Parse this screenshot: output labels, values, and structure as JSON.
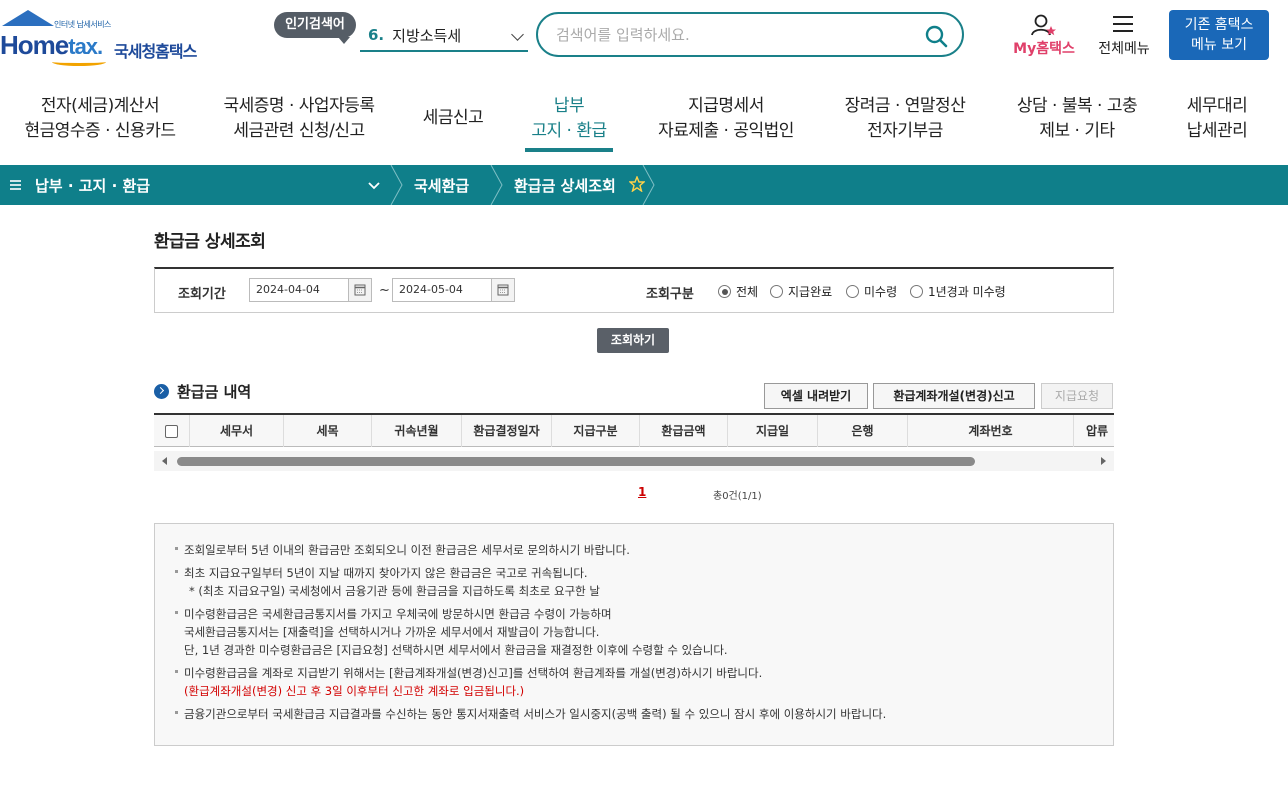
{
  "header": {
    "logo_tagline": "인터넷 납세서비스",
    "logo_home": "Home",
    "logo_tax": "tax.",
    "logo_kr": "국세청홈택스",
    "popular_label": "인기검색어",
    "popular_num": "6.",
    "popular_text": "지방소득세",
    "search_placeholder": "검색어를 입력하세요.",
    "my_hometax": "My홈택스",
    "all_menu": "전체메뉴",
    "legacy_line1": "기존 홈택스",
    "legacy_line2": "메뉴 보기"
  },
  "gnb": [
    {
      "line1": "전자(세금)계산서",
      "line2": "현금영수증 · 신용카드"
    },
    {
      "line1": "국세증명 · 사업자등록",
      "line2": "세금관련 신청/신고"
    },
    {
      "line1": "세금신고",
      "line2": ""
    },
    {
      "line1": "납부",
      "line2": "고지 · 환급"
    },
    {
      "line1": "지급명세서",
      "line2": "자료제출 · 공익법인"
    },
    {
      "line1": "장려금 · 연말정산",
      "line2": "전자기부금"
    },
    {
      "line1": "상담 · 불복 · 고충",
      "line2": "제보 · 기타"
    },
    {
      "line1": "세무대리",
      "line2": "납세관리"
    }
  ],
  "breadcrumb": {
    "menu": "납부 · 고지 · 환급",
    "item1": "국세환급",
    "item2": "환급금 상세조회"
  },
  "page": {
    "title": "환급금 상세조회",
    "period_label": "조회기간",
    "date_from": "2024-04-04",
    "date_to": "2024-05-04",
    "tilde": "~",
    "type_label": "조회구분",
    "radios": [
      "전체",
      "지급완료",
      "미수령",
      "1년경과 미수령"
    ],
    "selected_radio": "전체",
    "search_button": "조회하기"
  },
  "list": {
    "title": "환급금 내역",
    "excel_button": "엑셀 내려받기",
    "account_button": "환급계좌개설(변경)신고",
    "request_button": "지급요청",
    "columns": [
      "세무서",
      "세목",
      "귀속년월",
      "환급결정일자",
      "지급구분",
      "환급금액",
      "지급일",
      "은행",
      "계좌번호",
      "압류"
    ],
    "page_current": "1",
    "total": "총0건(1/1)"
  },
  "notice": {
    "l1": "조회일로부터 5년 이내의 환급금만 조회되오니 이전 환급금은 세무서로 문의하시기 바랍니다.",
    "l2": "최초 지급요구일부터 5년이 지날 때까지 찾아가지 않은 환급금은 국고로 귀속됩니다.",
    "l3": "* (최초 지급요구일) 국세청에서 금융기관 등에 환급금을 지급하도록 최초로 요구한 날",
    "l4": "미수령환급금은 국세환급금통지서를 가지고 우체국에 방문하시면 환급금 수령이 가능하며",
    "l5": "국세환급금통지서는 [재출력]을 선택하시거나 가까운 세무서에서 재발급이 가능합니다.",
    "l6": "단, 1년 경과한 미수령환급금은 [지급요청] 선택하시면 세무서에서 환급금을 재결정한 이후에 수령할 수 있습니다.",
    "l7": "미수령환급금을 계좌로 지급받기 위해서는 [환급계좌개설(변경)신고]를 선택하여 환급계좌를 개설(변경)하시기 바랍니다.",
    "l8": "(환급계좌개설(변경) 신고 후 3일 이후부터 신고한 계좌로 입금됩니다.)",
    "l9": "금융기관으로부터 국세환급금 지급결과를 수신하는 동안 통지서재출력 서비스가 일시중지(공백 출력) 될 수 있으니 잠시 후에 이용하시기 바랍니다."
  },
  "colors": {
    "teal": "#0f7f8a",
    "brand_blue": "#1e4a9a",
    "my_pink": "#e0406a",
    "legacy_blue": "#1a68b8",
    "notice_red": "#d20000"
  }
}
